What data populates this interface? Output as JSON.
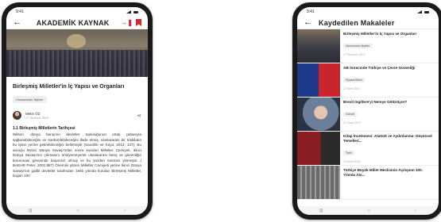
{
  "left": {
    "status_time": "9:41",
    "app_title": "AKADEMİK KAYNAK",
    "article_title": "Birleşmiş Milletler'in İç Yapısı ve Organları",
    "tag": "Uluslararası İlişkiler",
    "author": "Metin ÖZ",
    "date": "17 Temmuz 2019",
    "section_heading": "1.1 Birleşmiş Milletlerin Tarihçesi",
    "body": "Wilson, dünya barışının devletler topluluğunun ortak çabasıyla sağlanabileceğini ve sürdürülebileceğini ifade etmiş, uluslararası bir teşkilatın bu işlevi yerine getirebileceğini belirtmiştir (Sandıklı ve Kaya, 2014: 137). Bu amaçla Birinci Dünya Savaşı'ndan sonra kurulan Milletler Cemiyeti, ikinci Dünya Savaşı'nın çıkmasını önleyemeyerek uluslararası barış ve güvenliğin korunması görevinde başarısız olmuş ve bu yüzden önemini yitirmiştir. ( BAEHR Peter, 2001:887) Önemini yitiren Milletler Cemiyeti yerine İkinci Dünya Savaşı'nın galibi devletler tarafından 1945 yılında kurulan Birleşmiş Milletler, bugün 193"
  },
  "right": {
    "status_time": "9:41",
    "app_title": "Kaydedilen Makaleler",
    "items": [
      {
        "title": "Birleşmiş Milletler'in İç Yapısı ve Organları",
        "tag": "Uluslararası İlişkiler",
        "date": "17 Temmuz 2019"
      },
      {
        "title": "AB Sürecinde Türkiye ve Çevre Güvenliği",
        "tag": "Siyasal Bilimi",
        "date": "22 Mart 2019"
      },
      {
        "title": "Brexit İngiltere'yi Nereye Götürüyor?",
        "tag": "Güncel",
        "date": "27 Ocak 2019"
      },
      {
        "title": "Kitap İncelemesi: Atatürk ve Aydınlanma- Düşünsel Temelleri...",
        "tag": "Tarih",
        "date": "29 Ekim 2018"
      },
      {
        "title": "Türkiye Büyük Millet Meclisinin Açılışının 100. Yılında Ata...",
        "tag": "",
        "date": ""
      }
    ]
  },
  "nav": {
    "recent": "|||",
    "home": "○",
    "back": "‹"
  }
}
